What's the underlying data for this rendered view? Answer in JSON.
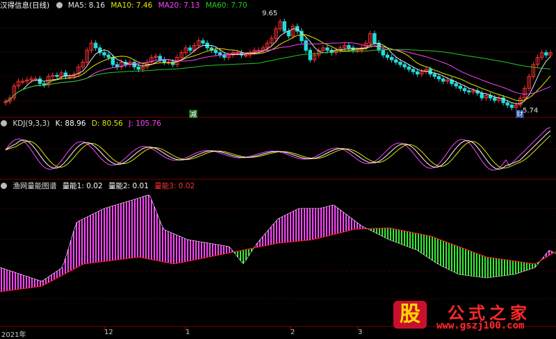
{
  "colors": {
    "ma5": "#e6e6e6",
    "ma10": "#e8e800",
    "ma20": "#ff44ff",
    "ma60": "#22cc22",
    "up": "#ff3232",
    "down": "#22dddd",
    "k": "#ffffff",
    "d": "#e8e800",
    "j": "#ff44ff",
    "energy_pos": "#ff44ff",
    "energy_neg": "#33ee33",
    "energy_line": "#ff2020",
    "grid": "#7a0000"
  },
  "price_panel": {
    "title": "汉得信息(日线)",
    "ma5": "MA5: 8.16",
    "ma10": "MA10: 7.46",
    "ma20": "MA20: 7.13",
    "ma60": "MA60: 7.70",
    "high_label": "9.65",
    "low_label": "5.74",
    "badge_reduce": "减",
    "badge_fin": "财"
  },
  "kdj_panel": {
    "name": "KDJ(9,3,3)",
    "k": "K: 88.96",
    "d": "D: 80.56",
    "j": "J: 105.76"
  },
  "energy_panel": {
    "name": "渔网量能图谱",
    "e1": "量能1: 0.02",
    "e2": "量能2: 0.01",
    "e3": "量能3: 0.02"
  },
  "x_axis": {
    "labels": [
      "2021年",
      "12",
      "1",
      "2",
      "3"
    ]
  },
  "watermark": {
    "logo": "股",
    "title": "公式之家",
    "url": "www.gszj100.com"
  },
  "chart_data": {
    "type": "line",
    "price": {
      "high_marker": 9.65,
      "low_marker": 5.74,
      "closes": [
        6.05,
        6.2,
        6.7,
        6.9,
        6.9,
        6.95,
        7.0,
        7.0,
        6.8,
        6.75,
        7.1,
        7.15,
        7.1,
        7.25,
        7.1,
        7.1,
        7.2,
        7.5,
        7.7,
        8.2,
        8.5,
        8.3,
        8.1,
        8.0,
        7.9,
        7.6,
        7.5,
        7.7,
        7.6,
        7.7,
        7.5,
        7.4,
        7.5,
        7.7,
        7.9,
        7.95,
        7.8,
        7.7,
        7.7,
        7.6,
        7.9,
        8.1,
        8.3,
        8.2,
        8.4,
        8.6,
        8.5,
        8.3,
        8.2,
        8.1,
        8.0,
        7.9,
        8.0,
        8.1,
        8.1,
        8.0,
        8.0,
        8.1,
        8.2,
        8.2,
        8.3,
        8.5,
        8.7,
        9.1,
        9.4,
        9.0,
        8.8,
        9.2,
        9.0,
        8.6,
        8.2,
        7.8,
        8.0,
        8.2,
        8.3,
        8.2,
        8.1,
        8.2,
        8.3,
        8.4,
        8.3,
        8.2,
        8.2,
        8.3,
        8.5,
        8.9,
        8.5,
        8.2,
        8.0,
        7.9,
        7.8,
        7.7,
        7.6,
        7.5,
        7.4,
        7.3,
        7.2,
        7.3,
        7.4,
        7.2,
        7.1,
        7.0,
        6.9,
        6.95,
        6.8,
        6.7,
        6.6,
        6.5,
        6.45,
        6.5,
        6.4,
        6.2,
        6.3,
        6.2,
        6.1,
        6.2,
        6.0,
        5.9,
        5.8,
        5.9,
        6.2,
        6.6,
        7.1,
        7.6,
        7.9,
        8.1,
        8.0,
        8.1
      ]
    },
    "kdj": {
      "k_last": 88.96,
      "d_last": 80.56,
      "j_last": 105.76
    },
    "energy": {
      "e1_last": 0.02,
      "e2_last": 0.01,
      "e3_last": 0.02
    }
  }
}
